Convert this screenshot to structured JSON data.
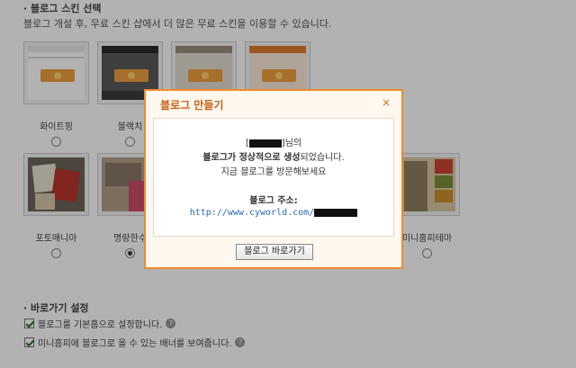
{
  "skin_section": {
    "title": "· 블로그 스킨 선택",
    "description": "블로그 개설 후, 무료 스킨 샵에서 더 많은 무료 스킨을 이용할 수 있습니다."
  },
  "skins_row1": [
    {
      "label": "화이트핑"
    },
    {
      "label": "블랙치"
    },
    {
      "label": ""
    },
    {
      "label": ""
    }
  ],
  "skins_row2": [
    {
      "label": "포토매니아"
    },
    {
      "label": "명랑한수"
    },
    {
      "label": "미니홈피테마"
    }
  ],
  "shortcut_section": {
    "title": "· 바로가기 설정",
    "options": [
      {
        "label": "블로그를 기본홈으로 설정합니다."
      },
      {
        "label": "미니홈피에 블로그로 올 수 있는 배너를 보여줍니다."
      }
    ]
  },
  "modal": {
    "title": "블로그 만들기",
    "close_symbol": "×",
    "bracket_open": "[",
    "user_suffix": "]님의",
    "success_bold": "블로그가 정상적으로 생성",
    "success_tail": "되었습니다.",
    "visit_prompt": "지금 블로그를 방문해보세요",
    "address_label": "블로그 주소:",
    "address_url": "http://www.cyworld.com/",
    "button_label": "블로그 바로가기"
  },
  "colors": {
    "accent": "#f08a2c",
    "modal_title": "#c8621a",
    "link": "#2a6ab0"
  }
}
